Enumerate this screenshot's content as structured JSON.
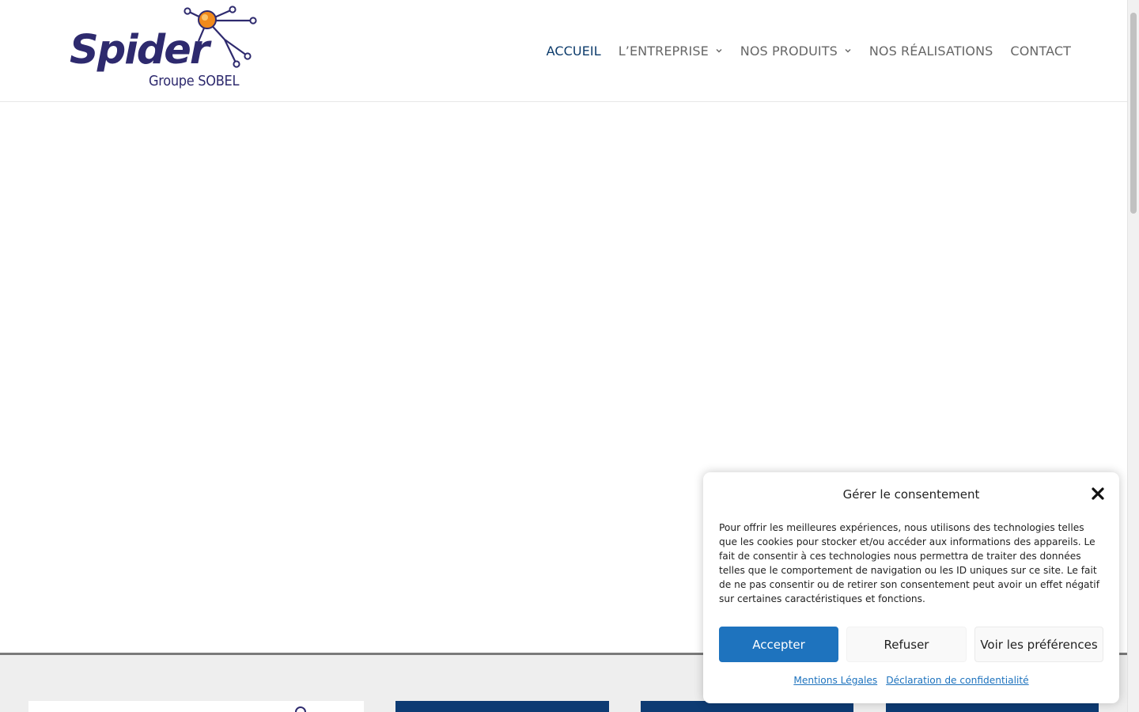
{
  "brand": {
    "name": "Spider",
    "subtitle": "Groupe SOBEL",
    "primary_color": "#2e2a6e",
    "accent_color": "#f08a1c"
  },
  "nav": {
    "items": [
      {
        "label": "ACCUEIL",
        "active": true,
        "dropdown": false
      },
      {
        "label": "L’ENTREPRISE",
        "active": false,
        "dropdown": true
      },
      {
        "label": "NOS PRODUITS",
        "active": false,
        "dropdown": true
      },
      {
        "label": "NOS RÉALISATIONS",
        "active": false,
        "dropdown": false
      },
      {
        "label": "CONTACT",
        "active": false,
        "dropdown": false
      }
    ],
    "active_color": "#0c3b6b",
    "text_color": "#666666"
  },
  "consent": {
    "title": "Gérer le consentement",
    "text": "Pour offrir les meilleures expériences, nous utilisons des technologies telles que les cookies pour stocker et/ou accéder aux informations des appareils. Le fait de consentir à ces technologies nous permettra de traiter des données telles que le comportement de navigation ou les ID uniques sur ce site. Le fait de ne pas consentir ou de retirer son consentement peut avoir un effet négatif sur certaines caractéristiques et fonctions.",
    "accept_label": "Accepter",
    "refuse_label": "Refuser",
    "preferences_label": "Voir les préférences",
    "links": {
      "legal": "Mentions Légales",
      "privacy": "Déclaration de confidentialité"
    },
    "accent_color": "#1e73be",
    "close_icon": "close-icon"
  },
  "footer": {
    "card_color": "#0d3b73"
  }
}
